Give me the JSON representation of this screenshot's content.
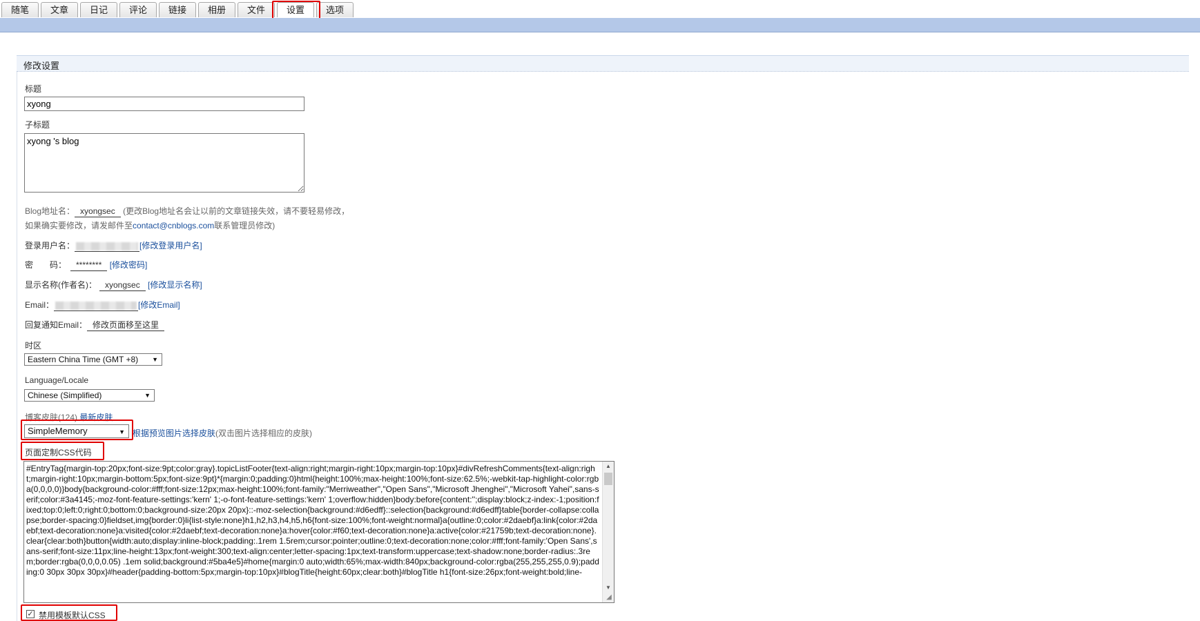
{
  "tabs": [
    {
      "label": "随笔"
    },
    {
      "label": "文章"
    },
    {
      "label": "日记"
    },
    {
      "label": "评论"
    },
    {
      "label": "链接"
    },
    {
      "label": "相册"
    },
    {
      "label": "文件"
    },
    {
      "label": "设置",
      "active": true
    },
    {
      "label": "选项"
    }
  ],
  "section": {
    "title": "修改设置"
  },
  "form": {
    "title_label": "标题",
    "title_value": "xyong",
    "subtitle_label": "子标题",
    "subtitle_value": "xyong 's blog",
    "alias_label": "Blog地址名：",
    "alias_value": "xyongsec",
    "alias_note_1": "(更改Blog地址名会让以前的文章链接失效，请不要轻易修改，",
    "alias_note_2": "如果确实要修改，请发邮件至",
    "alias_email": "contact@cnblogs.com",
    "alias_note_3": "联系管理员修改)",
    "login_label": "登录用户名：",
    "login_change_link": "[修改登录用户名]",
    "password_label": "密　　码：",
    "password_value": "********",
    "password_change_link": "[修改密码]",
    "display_label": "显示名称(作者名)：",
    "display_value": "xyongsec",
    "display_change_link": "[修改显示名称]",
    "email_label": "Email：",
    "email_change_link": "[修改Email]",
    "reply_email_label": "回复通知Email：",
    "reply_email_value": "修改页面移至这里",
    "timezone_label": "时区",
    "timezone_value": "Eastern China Time (GMT +8)",
    "locale_label": "Language/Locale",
    "locale_value": "Chinese (Simplified)",
    "skin_label": "博客皮肤(124)",
    "skin_latest_link": "最新皮肤",
    "skin_value": "SimpleMemory",
    "skin_preview_link": "根据预览图片选择皮肤",
    "skin_preview_note": "(双击图片选择相应的皮肤)",
    "css_label": "页面定制CSS代码",
    "css_code": "#EntryTag{margin-top:20px;font-size:9pt;color:gray}.topicListFooter{text-align:right;margin-right:10px;margin-top:10px}#divRefreshComments{text-align:right;margin-right:10px;margin-bottom:5px;font-size:9pt}*{margin:0;padding:0}html{height:100%;max-height:100%;font-size:62.5%;-webkit-tap-highlight-color:rgba(0,0,0,0)}body{background-color:#fff;font-size:12px;max-height:100%;font-family:\"Merriweather\",\"Open Sans\",\"Microsoft Jhenghei\",\"Microsoft Yahei\",sans-serif;color:#3a4145;-moz-font-feature-settings:'kern' 1;-o-font-feature-settings:'kern' 1;overflow:hidden}body:before{content:'';display:block;z-index:-1;position:fixed;top:0;left:0;right:0;bottom:0;background-size:20px 20px}::-moz-selection{background:#d6edff}::selection{background:#d6edff}table{border-collapse:collapse;border-spacing:0}fieldset,img{border:0}li{list-style:none}h1,h2,h3,h4,h5,h6{font-size:100%;font-weight:normal}a{outline:0;color:#2daebf}a:link{color:#2daebf;text-decoration:none}a:visited{color:#2daebf;text-decoration:none}a:hover{color:#f60;text-decoration:none}a:active{color:#21759b;text-decoration:none}.clear{clear:both}button{width:auto;display:inline-block;padding:.1rem 1.5rem;cursor:pointer;outline:0;text-decoration:none;color:#fff;font-family:'Open Sans',sans-serif;font-size:11px;line-height:13px;font-weight:300;text-align:center;letter-spacing:1px;text-transform:uppercase;text-shadow:none;border-radius:.3rem;border:rgba(0,0,0,0.05) .1em solid;background:#5ba4e5}#home{margin:0 auto;width:65%;max-width:840px;background-color:rgba(255,255,255,0.9);padding:0 30px 30px 30px}#header{padding-bottom:5px;margin-top:10px}#blogTitle{height:60px;clear:both}#blogTitle h1{font-size:26px;font-weight:bold;line-",
    "disable_default_css_label": "禁用模板默认CSS",
    "disable_default_css_checked": true
  },
  "colors": {
    "highlight": "#e00000",
    "link": "#1a4f9c",
    "band": "#b4c8e8"
  }
}
